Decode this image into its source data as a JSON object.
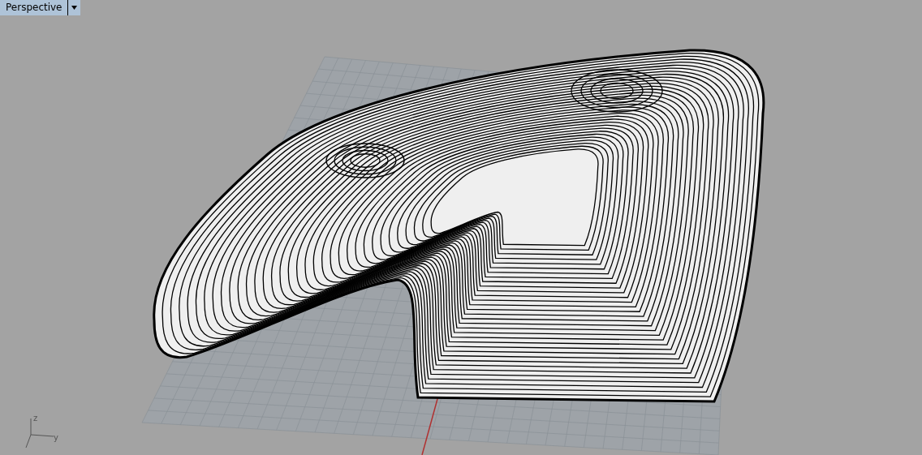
{
  "viewport": {
    "tab": {
      "label": "Perspective"
    },
    "axis_labels": [
      "z",
      "y"
    ]
  }
}
